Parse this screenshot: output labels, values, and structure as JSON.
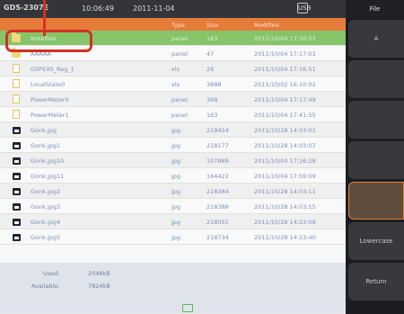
{
  "topbar": {
    "model": "GDS-2307E",
    "time": "10:06:49",
    "date": "2011-11-04",
    "usb": "USB"
  },
  "list": {
    "columns": [
      "Type",
      "Size",
      "Modified"
    ],
    "rows": [
      {
        "icon": "folder-icon",
        "name": "Notefiles",
        "type": "panel",
        "size": "163",
        "modified": "2011/10/04  17:10:53"
      },
      {
        "icon": "folder-icon",
        "name": "AAAAA",
        "type": "panel",
        "size": "47",
        "modified": "2011/10/04  17:17:03"
      },
      {
        "icon": "folder-icon",
        "name": "GSPEXS_Reg_1",
        "type": "xls",
        "size": "26",
        "modified": "2011/10/04  17:16:51"
      },
      {
        "icon": "folder-icon",
        "name": "LocalState0",
        "type": "xls",
        "size": "3888",
        "modified": "2011/10/02  16:10:02"
      },
      {
        "icon": "folder-icon",
        "name": "PowerMeter0",
        "type": "panel",
        "size": "368",
        "modified": "2011/10/04  17:17:49"
      },
      {
        "icon": "folder-icon",
        "name": "PowerMeter1",
        "type": "panel",
        "size": "163",
        "modified": "2011/10/04  17:41:55"
      },
      {
        "icon": "image-icon",
        "name": "Gonk.jpg",
        "type": "jpg",
        "size": "218454",
        "modified": "2011/10/28  14:03:01"
      },
      {
        "icon": "image-icon",
        "name": "Gonk.jpg1",
        "type": "jpg",
        "size": "218177",
        "modified": "2011/10/28  14:03:07"
      },
      {
        "icon": "image-icon",
        "name": "Gonk.jpg10",
        "type": "jpg",
        "size": "107889",
        "modified": "2011/10/04  17:16:28"
      },
      {
        "icon": "image-icon",
        "name": "Gonk.jpg11",
        "type": "jpg",
        "size": "164422",
        "modified": "2011/10/04  17:59:09"
      },
      {
        "icon": "image-icon",
        "name": "Gonk.jpg2",
        "type": "jpg",
        "size": "218384",
        "modified": "2011/10/28  14:03:11"
      },
      {
        "icon": "image-icon",
        "name": "Gonk.jpg3",
        "type": "jpg",
        "size": "218388",
        "modified": "2011/10/28  14:03:15"
      },
      {
        "icon": "image-icon",
        "name": "Gonk.jpg4",
        "type": "jpg",
        "size": "218051",
        "modified": "2011/10/28  14:23:09"
      },
      {
        "icon": "image-icon",
        "name": "Gonk.jpg5",
        "type": "jpg",
        "size": "218734",
        "modified": "2011/10/28  14:23:40"
      }
    ]
  },
  "footer": {
    "used_label": "Used:",
    "used_value": "2048kB",
    "available_label": "Available:",
    "available_value": "7824kB"
  },
  "sidebar": {
    "title": "File",
    "buttons": [
      "A",
      "",
      "",
      "",
      "",
      "Lowercase",
      "Return"
    ]
  }
}
